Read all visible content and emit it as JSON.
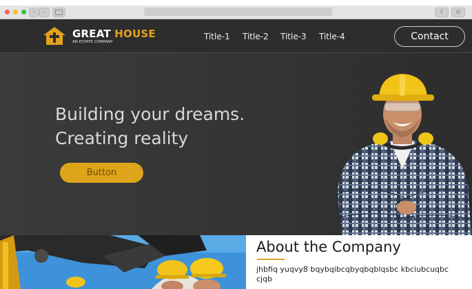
{
  "browser": {
    "back_icon": "chevron-left-icon",
    "forward_icon": "chevron-right-icon",
    "sidebar_icon": "sidebar-icon",
    "share_icon": "share-icon",
    "tabs_icon": "tabs-icon"
  },
  "header": {
    "logo_icon": "house-cross-icon",
    "brand_primary": "GREAT",
    "brand_accent": "HOUSE",
    "brand_sub": "AN ESTATE COMPANY",
    "nav": [
      "Title-1",
      "Title-2",
      "Title-3",
      "Title-4"
    ],
    "contact_label": "Contact"
  },
  "hero": {
    "title_line1": "Building your dreams.",
    "title_line2": "Creating reality",
    "button_label": "Button"
  },
  "about": {
    "title": "About the Company",
    "text": "jhbfiq yuqvy8 bqybqibcqbyqbqblqsbc kbciubcuqbc cjqb"
  },
  "colors": {
    "accent": "#e2a31c",
    "header_bg": "#2e2d2d",
    "hero_bg": "#3a3939"
  }
}
